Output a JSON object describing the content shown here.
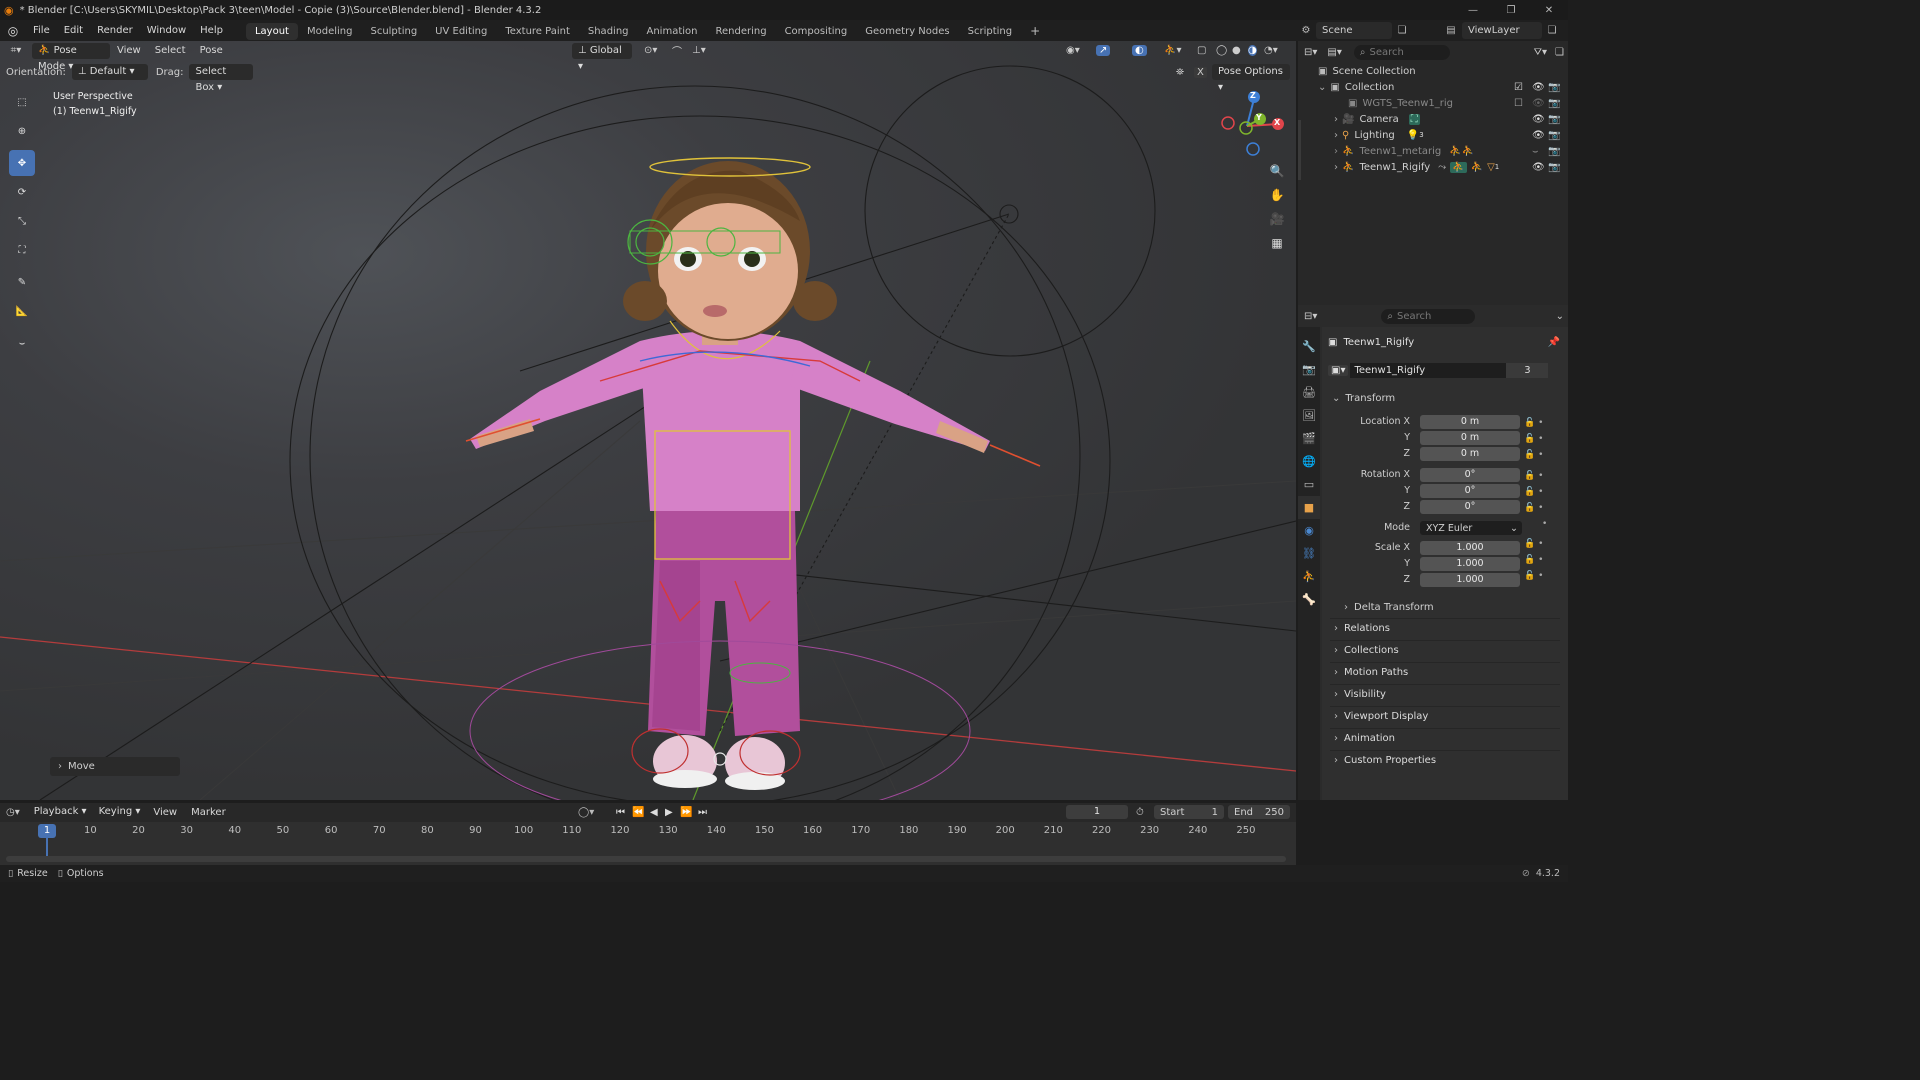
{
  "titlebar": {
    "title": "* Blender [C:\\Users\\SKYMIL\\Desktop\\Pack 3\\teen\\Model - Copie (3)\\Source\\Blender.blend] - Blender 4.3.2"
  },
  "menu": [
    "File",
    "Edit",
    "Render",
    "Window",
    "Help"
  ],
  "workspaces": [
    "Layout",
    "Modeling",
    "Sculpting",
    "UV Editing",
    "Texture Paint",
    "Shading",
    "Animation",
    "Rendering",
    "Compositing",
    "Geometry Nodes",
    "Scripting"
  ],
  "active_workspace": "Layout",
  "scene": {
    "label": "Scene",
    "viewlayer": "ViewLayer"
  },
  "viewport": {
    "mode": "Pose Mode",
    "menus": [
      "View",
      "Select",
      "Pose"
    ],
    "transform_orientation": "Global",
    "orientation_label": "Orientation:",
    "orientation_value": "Default",
    "drag_label": "Drag:",
    "drag_value": "Select Box",
    "pose_options": "Pose Options",
    "overlay_title": "User Perspective",
    "overlay_object": "(1) Teenw1_Rigify",
    "last_op": "Move",
    "gizmo": {
      "x": "X",
      "y": "Y",
      "z": "Z"
    }
  },
  "outliner": {
    "search_placeholder": "Search",
    "rows": [
      {
        "name": "Scene Collection"
      },
      {
        "name": "Collection"
      },
      {
        "name": "WGTS_Teenw1_rig"
      },
      {
        "name": "Camera"
      },
      {
        "name": "Lighting",
        "badge": "3"
      },
      {
        "name": "Teenw1_metarig"
      },
      {
        "name": "Teenw1_Rigify",
        "badge": "1"
      }
    ]
  },
  "properties": {
    "search_placeholder": "Search",
    "object_name": "Teenw1_Rigify",
    "data_name": "Teenw1_Rigify",
    "users": "3",
    "transform_label": "Transform",
    "location_label": "Location X",
    "location": [
      "0 m",
      "0 m",
      "0 m"
    ],
    "rotation_label": "Rotation X",
    "rotation": [
      "0°",
      "0°",
      "0°"
    ],
    "mode_label": "Mode",
    "mode_value": "XYZ Euler",
    "scale_label": "Scale X",
    "scale": [
      "1.000",
      "1.000",
      "1.000"
    ],
    "axis_y": "Y",
    "axis_z": "Z",
    "delta": "Delta Transform",
    "panels": [
      "Relations",
      "Collections",
      "Motion Paths",
      "Visibility",
      "Viewport Display",
      "Animation",
      "Custom Properties"
    ]
  },
  "timeline": {
    "menus": [
      "Playback",
      "Keying",
      "View",
      "Marker"
    ],
    "current_frame": "1",
    "start_label": "Start",
    "start": "1",
    "end_label": "End",
    "end": "250",
    "ticks": [
      "10",
      "20",
      "30",
      "40",
      "50",
      "60",
      "70",
      "80",
      "90",
      "100",
      "110",
      "120",
      "130",
      "140",
      "150",
      "160",
      "170",
      "180",
      "190",
      "200",
      "210",
      "220",
      "230",
      "240",
      "250"
    ],
    "playhead": "1"
  },
  "statusbar": {
    "resize": "Resize",
    "options": "Options",
    "version": "4.3.2"
  },
  "colors": {
    "accent": "#4772b3",
    "x_axis": "#e0454b",
    "y_axis": "#7fb52c",
    "z_axis": "#3d7fd6"
  }
}
